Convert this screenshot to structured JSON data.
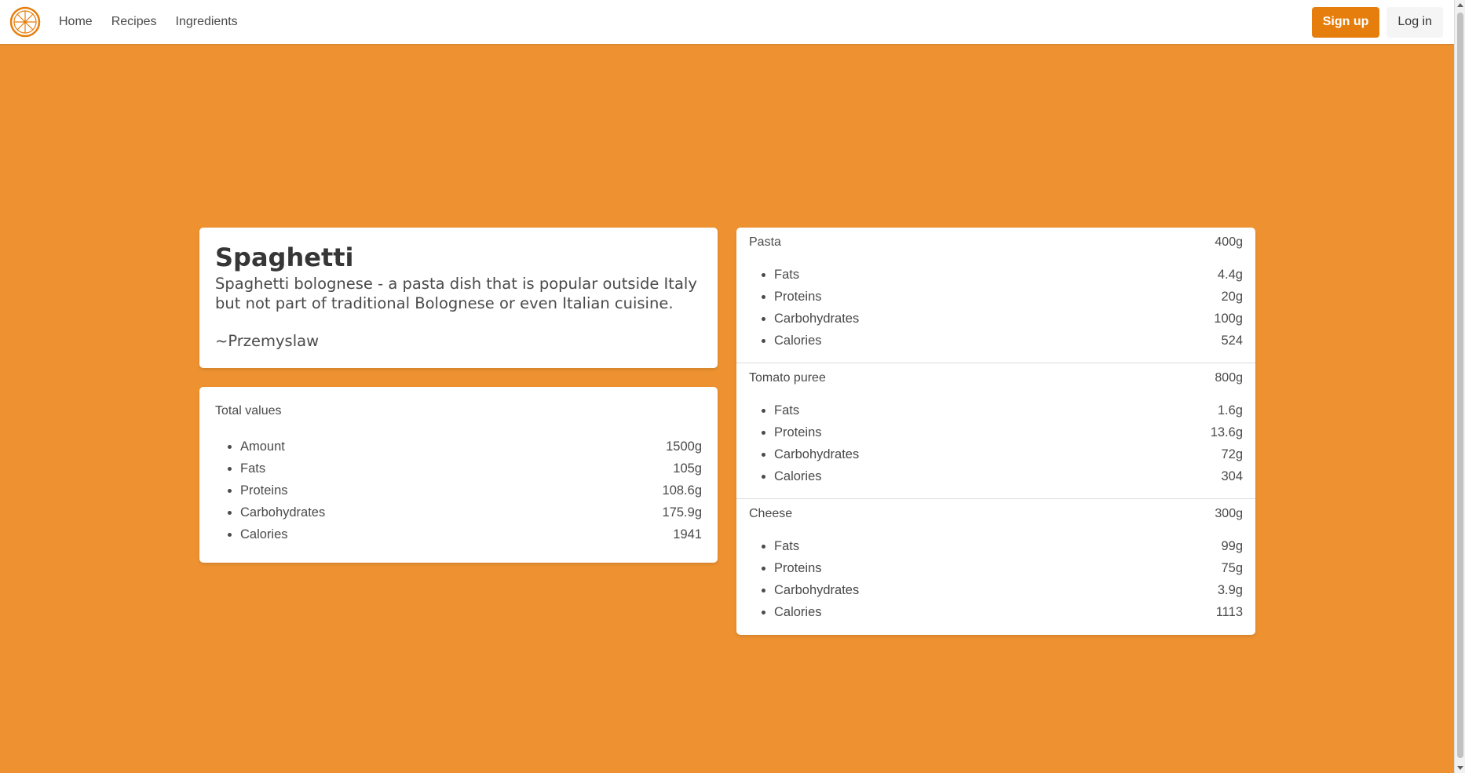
{
  "nav": {
    "logo_icon": "orange-slice-icon",
    "links": [
      "Home",
      "Recipes",
      "Ingredients"
    ],
    "signup_label": "Sign up",
    "login_label": "Log in"
  },
  "colors": {
    "background": "#ee9231",
    "primary": "#e67e0e",
    "card": "#ffffff"
  },
  "recipe": {
    "title": "Spaghetti",
    "description": "Spaghetti bolognese - a pasta dish that is popular outside Italy but not part of traditional Bolognese or even Italian cuisine.",
    "author": "~Przemyslaw"
  },
  "totals": {
    "heading": "Total values",
    "items": [
      {
        "label": "Amount",
        "value": "1500g"
      },
      {
        "label": "Fats",
        "value": "105g"
      },
      {
        "label": "Proteins",
        "value": "108.6g"
      },
      {
        "label": "Carbohydrates",
        "value": "175.9g"
      },
      {
        "label": "Calories",
        "value": "1941"
      }
    ]
  },
  "ingredients": [
    {
      "name": "Pasta",
      "amount": "400g",
      "items": [
        {
          "label": "Fats",
          "value": "4.4g"
        },
        {
          "label": "Proteins",
          "value": "20g"
        },
        {
          "label": "Carbohydrates",
          "value": "100g"
        },
        {
          "label": "Calories",
          "value": "524"
        }
      ]
    },
    {
      "name": "Tomato puree",
      "amount": "800g",
      "items": [
        {
          "label": "Fats",
          "value": "1.6g"
        },
        {
          "label": "Proteins",
          "value": "13.6g"
        },
        {
          "label": "Carbohydrates",
          "value": "72g"
        },
        {
          "label": "Calories",
          "value": "304"
        }
      ]
    },
    {
      "name": "Cheese",
      "amount": "300g",
      "items": [
        {
          "label": "Fats",
          "value": "99g"
        },
        {
          "label": "Proteins",
          "value": "75g"
        },
        {
          "label": "Carbohydrates",
          "value": "3.9g"
        },
        {
          "label": "Calories",
          "value": "1113"
        }
      ]
    }
  ]
}
